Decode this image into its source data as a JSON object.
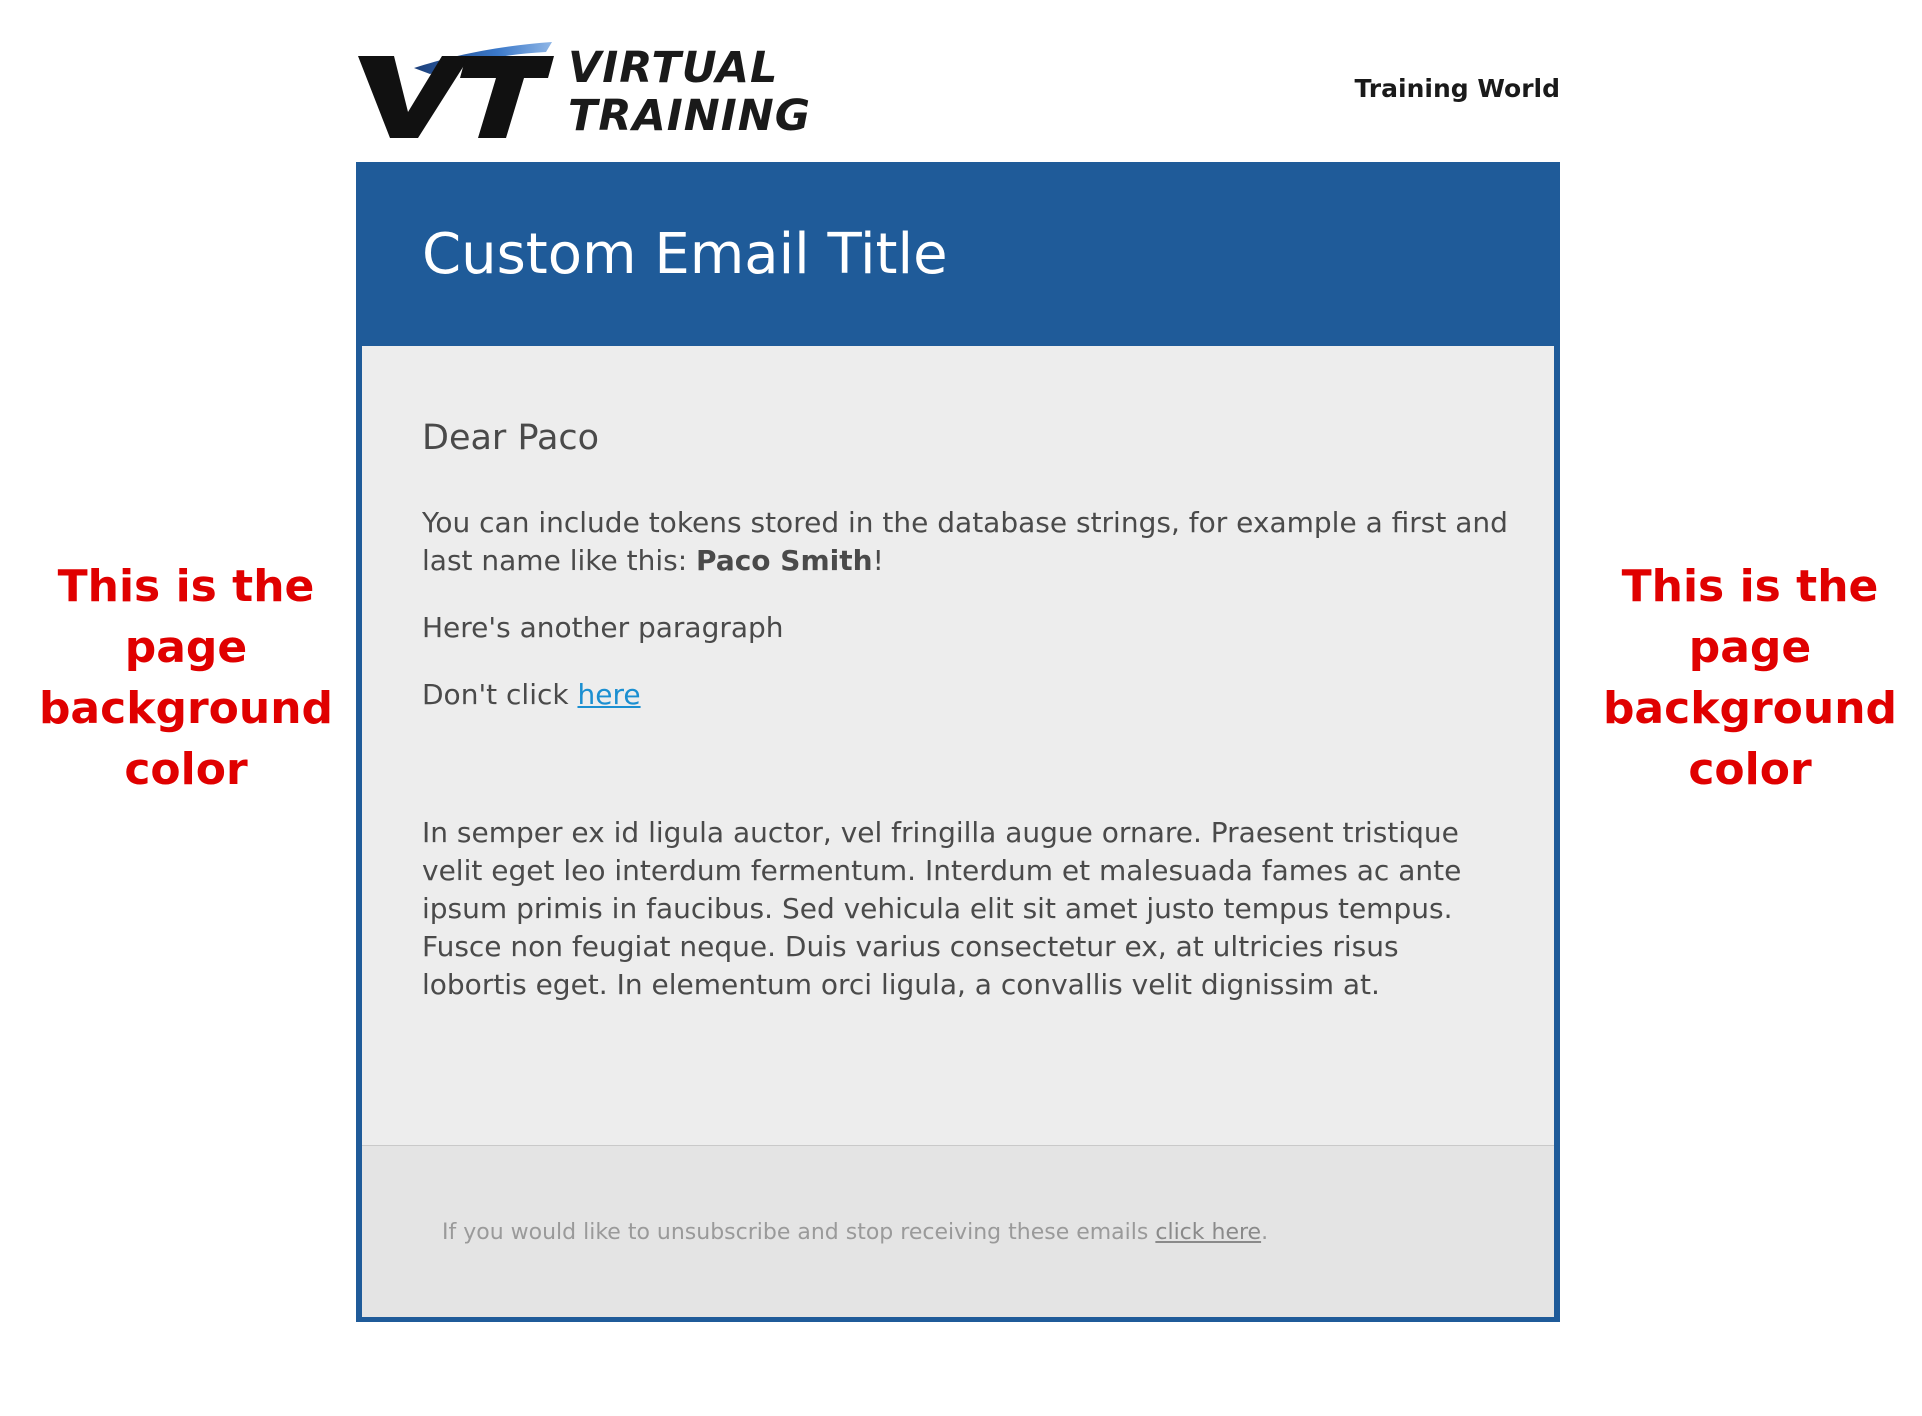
{
  "annotation": {
    "left_lines": [
      "This is the",
      "page",
      "background",
      "color"
    ],
    "right_lines": [
      "This is the",
      "page",
      "background",
      "color"
    ],
    "color": "#e00000"
  },
  "header": {
    "logo_mark_text": "VT",
    "logo_line1": "VIRTUAL",
    "logo_line2": "TRAINING",
    "brand_name": "Training World"
  },
  "email": {
    "title": "Custom Email Title",
    "greeting": "Dear Paco",
    "p1_text": "You can include tokens stored in the database strings, for example a first and last name like this: ",
    "p1_name": "Paco Smith",
    "p1_end": "!",
    "p2": "Here's another paragraph",
    "p3_text": "Don't click ",
    "p3_link": "here",
    "lorem": "In semper ex id ligula auctor, vel fringilla augue ornare. Praesent tristique velit eget leo interdum fermentum. Interdum et malesuada fames ac ante ipsum primis in faucibus. Sed vehicula elit sit amet justo tempus tempus. Fusce non feugiat neque. Duis varius consectetur ex, at ultricies risus lobortis eget. In elementum orci ligula, a convallis velit dignissim at."
  },
  "footer": {
    "text": "If you would like to unsubscribe and stop receiving these emails ",
    "link": "click here",
    "end": "."
  },
  "colors": {
    "brand_blue": "#1f5b99",
    "content_bg": "#ededed",
    "footer_bg": "#e4e4e4",
    "link": "#1b8fd1"
  }
}
